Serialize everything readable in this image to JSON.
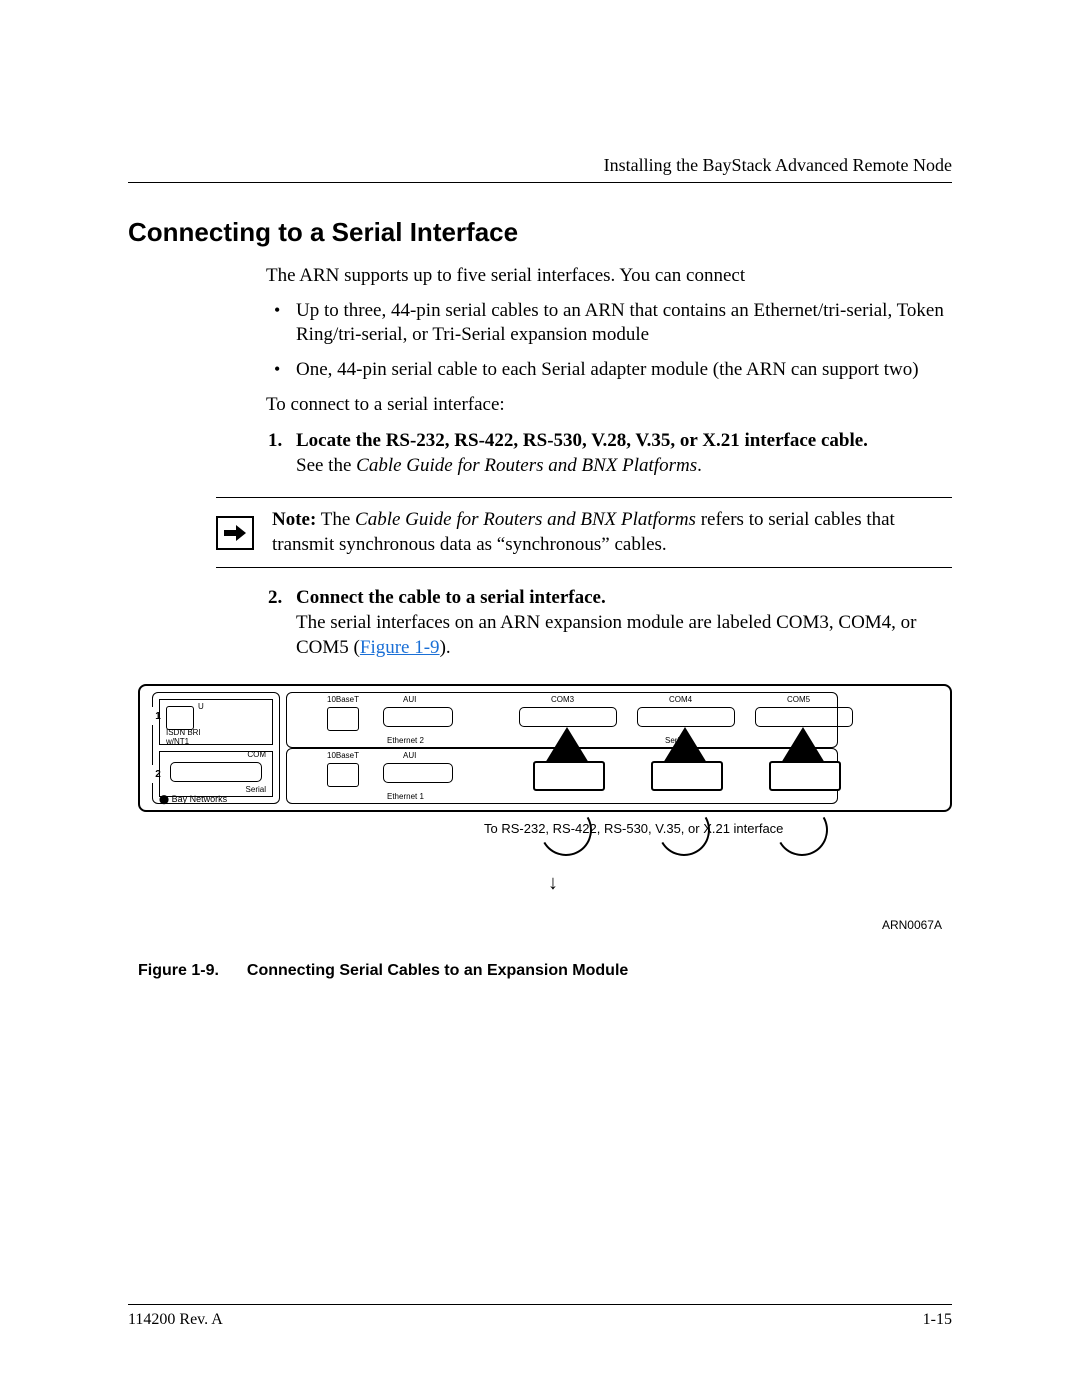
{
  "header": {
    "runningTitle": "Installing the BayStack Advanced Remote Node"
  },
  "section": {
    "title": "Connecting to a Serial Interface",
    "intro": "The ARN supports up to five serial interfaces. You can connect",
    "bullets": [
      "Up to three, 44-pin serial cables to an ARN that contains an Ethernet/tri-serial, Token Ring/tri-serial, or Tri-Serial expansion module",
      "One, 44-pin serial cable to each Serial adapter module (the ARN can support two)"
    ],
    "lead2": "To connect to a serial interface:",
    "steps": [
      {
        "title": "Locate the RS-232, RS-422, RS-530, V.28, V.35, or X.21 interface cable.",
        "bodyPrefix": "See the ",
        "bodyItalic": "Cable Guide for Routers and BNX Platforms",
        "bodySuffix": "."
      },
      {
        "title": "Connect the cable to a serial interface.",
        "body": "The serial interfaces on an ARN expansion module are labeled COM3, COM4, or COM5 (",
        "linkText": "Figure 1-9",
        "bodyAfter": ")."
      }
    ],
    "note": {
      "label": "Note:",
      "prefix": " The ",
      "italic": "Cable Guide for Routers and BNX Platforms",
      "suffix": " refers to serial cables that transmit synchronous data as “synchronous” cables."
    }
  },
  "figure": {
    "labels": {
      "isdn": "ISDN BRI\nw/NT1",
      "com": "COM",
      "serial": "Serial",
      "bay": "Bay Networks",
      "tenBaseT": "10BaseT",
      "aui": "AUI",
      "eth1": "Ethernet 1",
      "eth2": "Ethernet 2",
      "com3": "COM3",
      "com4": "COM4",
      "com5": "COM5",
      "serialGroup": "Serial",
      "u": "U"
    },
    "annotation": "To\nRS-232,\nRS-422,\nRS-530,\nV.35,\nor X.21\ninterface",
    "id": "ARN0067A",
    "caption": {
      "label": "Figure 1-9.",
      "text": "Connecting Serial Cables to an Expansion Module"
    }
  },
  "footer": {
    "left": "114200 Rev. A",
    "right": "1-15"
  }
}
